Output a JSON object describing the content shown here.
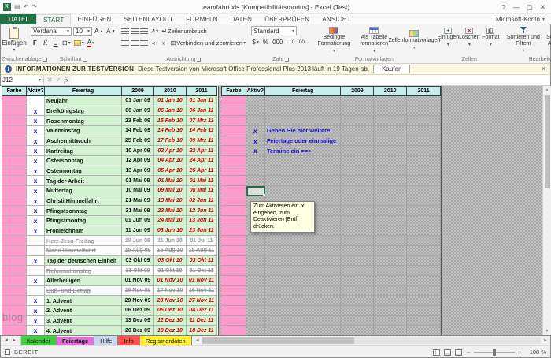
{
  "window": {
    "title": "teamfahrt.xls [Kompatibilitätsmodus] - Excel (Test)",
    "account_label": "Microsoft-Konto"
  },
  "ribbon_tabs": {
    "file": "DATEI",
    "start": "START",
    "insert": "EINFÜGEN",
    "pagelayout": "SEITENLAYOUT",
    "formulas": "FORMELN",
    "data": "DATEN",
    "review": "ÜBERPRÜFEN",
    "view": "ANSICHT"
  },
  "ribbon": {
    "paste_label": "Einfügen",
    "clipboard_group": "Zwischenablage",
    "font_name": "Verdana",
    "font_size": "10",
    "bold": "F",
    "italic": "K",
    "underline": "U",
    "font_group": "Schriftart",
    "wrap_label": "Zeilenumbruch",
    "merge_label": "Verbinden und zentrieren",
    "align_group": "Ausrichtung",
    "number_format": "Standard",
    "number_group": "Zahl",
    "styles": [
      "Bedingte Formatierung",
      "Als Tabelle formatieren",
      "Zellenformatvorlagen"
    ],
    "styles_group": "Formatvorlagen",
    "cells_buttons": [
      "Einfügen",
      "Löschen",
      "Format"
    ],
    "cells_group": "Zellen",
    "editing_buttons": [
      "Sortieren und Filtern",
      "Suchen und Auswählen"
    ],
    "editing_group": "Bearbeiten"
  },
  "notification": {
    "title": "INFORMATIONEN ZUR TESTVERSION",
    "message": "Diese Testversion von Microsoft Office Professional Plus 2013 läuft in 19 Tagen ab.",
    "button": "Kaufen"
  },
  "formula_bar": {
    "cell_ref": "J12",
    "fx": "fx",
    "value": ""
  },
  "grid": {
    "headers": [
      "Farbe",
      "Aktiv?",
      "Feiertag",
      "2009",
      "2010",
      "2011"
    ],
    "rows": [
      {
        "name": "Neujahr",
        "x": "",
        "active": true,
        "d1": "01 Jan 09",
        "d2": "01 Jan 10",
        "d3": "01 Jan 11"
      },
      {
        "name": "Dreikönigstag",
        "x": "x",
        "active": true,
        "d1": "06 Jan 09",
        "d2": "06 Jan 10",
        "d3": "06 Jan 11"
      },
      {
        "name": "Rosenmontag",
        "x": "x",
        "active": true,
        "d1": "23 Feb 09",
        "d2": "15 Feb 10",
        "d3": "07 Mrz 11"
      },
      {
        "name": "Valentinstag",
        "x": "x",
        "active": true,
        "d1": "14 Feb 09",
        "d2": "14 Feb 10",
        "d3": "14 Feb 11"
      },
      {
        "name": "Aschermittwoch",
        "x": "x",
        "active": true,
        "d1": "25 Feb 09",
        "d2": "17 Feb 10",
        "d3": "09 Mrz 11"
      },
      {
        "name": "Karfreitag",
        "x": "x",
        "active": true,
        "d1": "10 Apr 09",
        "d2": "02 Apr 10",
        "d3": "22 Apr 11"
      },
      {
        "name": "Ostersonntag",
        "x": "x",
        "active": true,
        "d1": "12 Apr 09",
        "d2": "04 Apr 10",
        "d3": "24 Apr 11"
      },
      {
        "name": "Ostermontag",
        "x": "x",
        "active": true,
        "d1": "13 Apr 09",
        "d2": "05 Apr 10",
        "d3": "25 Apr 11"
      },
      {
        "name": "Tag der Arbeit",
        "x": "x",
        "active": true,
        "d1": "01 Mai 09",
        "d2": "01 Mai 10",
        "d3": "01 Mai 11"
      },
      {
        "name": "Muttertag",
        "x": "x",
        "active": true,
        "d1": "10 Mai 09",
        "d2": "09 Mai 10",
        "d3": "08 Mai 11"
      },
      {
        "name": "Christi Himmelfahrt",
        "x": "x",
        "active": true,
        "d1": "21 Mai 09",
        "d2": "13 Mai 10",
        "d3": "02 Jun 11"
      },
      {
        "name": "Pfingstsonntag",
        "x": "x",
        "active": true,
        "d1": "31 Mai 09",
        "d2": "23 Mai 10",
        "d3": "12 Jun 11"
      },
      {
        "name": "Pfingstmontag",
        "x": "x",
        "active": true,
        "d1": "01 Jun 09",
        "d2": "24 Mai 10",
        "d3": "13 Jun 11"
      },
      {
        "name": "Fronleichnam",
        "x": "x",
        "active": true,
        "d1": "11 Jun 09",
        "d2": "03 Jun 10",
        "d3": "23 Jun 11"
      },
      {
        "name": "Herz-Jesu-Freitag",
        "x": "",
        "active": false,
        "d1": "19 Jun 09",
        "d2": "11 Jun 10",
        "d3": "01 Jul 11"
      },
      {
        "name": "Maria Himmelfahrt",
        "x": "",
        "active": false,
        "d1": "15 Aug 09",
        "d2": "15 Aug 10",
        "d3": "15 Aug 11"
      },
      {
        "name": "Tag der deutschen Einheit",
        "x": "x",
        "active": true,
        "d1": "03 Okt 09",
        "d2": "03 Okt 10",
        "d3": "03 Okt 11"
      },
      {
        "name": "Reformationstag",
        "x": "",
        "active": false,
        "d1": "31 Okt 09",
        "d2": "31 Okt 10",
        "d3": "31 Okt 11"
      },
      {
        "name": "Allerheiligen",
        "x": "x",
        "active": true,
        "d1": "01 Nov 09",
        "d2": "01 Nov 10",
        "d3": "01 Nov 11"
      },
      {
        "name": "Buß- und Bettag",
        "x": "",
        "active": false,
        "d1": "18 Nov 09",
        "d2": "17 Nov 10",
        "d3": "16 Nov 11"
      },
      {
        "name": "1. Advent",
        "x": "x",
        "active": true,
        "d1": "29 Nov 09",
        "d2": "28 Nov 10",
        "d3": "27 Nov 11"
      },
      {
        "name": "2. Advent",
        "x": "x",
        "active": true,
        "d1": "06 Dez 09",
        "d2": "05 Dez 10",
        "d3": "04 Dez 11"
      },
      {
        "name": "3. Advent",
        "x": "x",
        "active": true,
        "d1": "13 Dez 09",
        "d2": "12 Dez 10",
        "d3": "11 Dez 11"
      },
      {
        "name": "4. Advent",
        "x": "x",
        "active": true,
        "d1": "20 Dez 09",
        "d2": "19 Dez 10",
        "d3": "18 Dez 11"
      }
    ],
    "right_notes": [
      "Geben Sie hier weitere",
      "Feiertage oder einmalige",
      "Termine ein ==>"
    ],
    "tooltip": "Zum Aktivieren ein 'x' eingeben, zum Deaktivieren [Entf] drücken."
  },
  "sheet_tabs": [
    {
      "label": "Kalender",
      "color": "#3fcc3f",
      "active": false
    },
    {
      "label": "Feiertage",
      "color": "#e070d8",
      "active": true
    },
    {
      "label": "Hilfe",
      "color": "#c9d6f0",
      "active": false
    },
    {
      "label": "Info",
      "color": "#ff5050",
      "active": false
    },
    {
      "label": "Registrierdaten",
      "color": "#ffee33",
      "active": false
    }
  ],
  "status_bar": {
    "mode": "BEREIT",
    "zoom": "100 %"
  },
  "watermark": "blog",
  "colors": {
    "excel_green": "#217346",
    "farbe_pink": "#ff9bcb",
    "row_green": "#d3f3d3",
    "header_cyan": "#c7eded",
    "date_red": "#d90000",
    "x_blue": "#1414cc"
  }
}
